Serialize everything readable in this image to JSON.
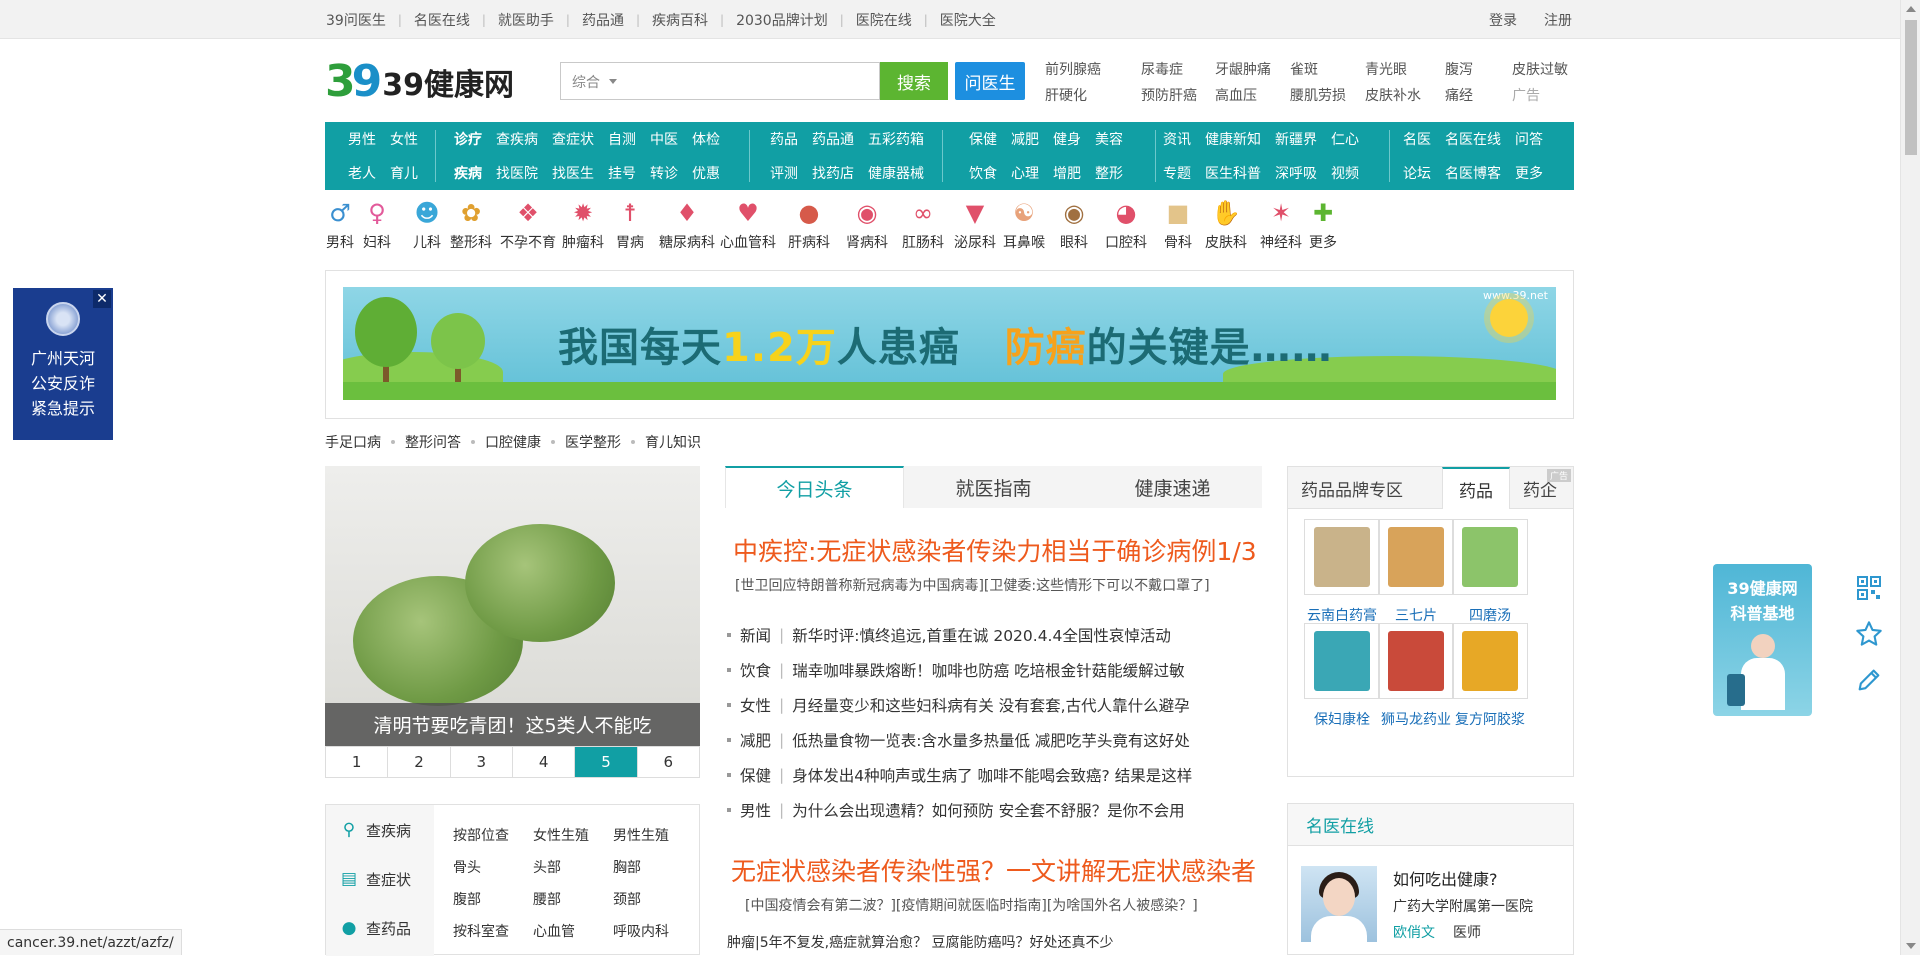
{
  "topbar": {
    "links": [
      "39问医生",
      "名医在线",
      "就医助手",
      "药品通",
      "疾病百科",
      "2030品牌计划",
      "医院在线",
      "医院大全"
    ],
    "login": "登录",
    "register": "注册"
  },
  "logo": {
    "digits_3": "3",
    "digits_9": "9",
    "name": "39健康网"
  },
  "search": {
    "category": "综合",
    "button": "搜索",
    "ask_doctor": "问医生"
  },
  "hotwords": {
    "row1": [
      "前列腺癌",
      "尿毒症",
      "牙龈肿痛",
      "雀斑",
      "青光眼",
      "腹泻",
      "皮肤过敏"
    ],
    "row2": [
      "肝硬化",
      "预防肝癌",
      "高血压",
      "腰肌劳损",
      "皮肤补水",
      "痛经",
      "广告"
    ]
  },
  "nav": {
    "g1": {
      "r1": [
        "男性",
        "女性"
      ],
      "r2": [
        "老人",
        "育儿"
      ]
    },
    "g2": {
      "r1": [
        "诊疗",
        "查疾病",
        "查症状",
        "自测",
        "中医",
        "体检"
      ],
      "r2": [
        "疾病",
        "找医院",
        "找医生",
        "挂号",
        "转诊",
        "优惠"
      ]
    },
    "g3": {
      "r1": [
        "药品",
        "药品通",
        "五彩药箱"
      ],
      "r2": [
        "评测",
        "找药店",
        "健康器械"
      ]
    },
    "g4": {
      "r1": [
        "保健",
        "减肥",
        "健身",
        "美容"
      ],
      "r2": [
        "饮食",
        "心理",
        "增肥",
        "整形"
      ]
    },
    "g5": {
      "r1": [
        "资讯",
        "健康新知",
        "新疆界",
        "仁心"
      ],
      "r2": [
        "专题",
        "医生科普",
        "深呼吸",
        "视频"
      ]
    },
    "g6": {
      "r1": [
        "名医",
        "名医在线",
        "问答"
      ],
      "r2": [
        "论坛",
        "名医博客",
        "更多"
      ]
    }
  },
  "depts": [
    {
      "label": "男科",
      "icon": "male-icon"
    },
    {
      "label": "妇科",
      "icon": "female-icon"
    },
    {
      "label": "儿科",
      "icon": "child-icon"
    },
    {
      "label": "整形科",
      "icon": "plastic-surgery-icon"
    },
    {
      "label": "不孕不育",
      "icon": "infertility-icon"
    },
    {
      "label": "肿瘤科",
      "icon": "tumor-icon"
    },
    {
      "label": "胃病",
      "icon": "stomach-icon"
    },
    {
      "label": "糖尿病科",
      "icon": "diabetes-icon"
    },
    {
      "label": "心血管科",
      "icon": "heart-icon"
    },
    {
      "label": "肝病科",
      "icon": "liver-icon"
    },
    {
      "label": "肾病科",
      "icon": "kidney-icon"
    },
    {
      "label": "肛肠科",
      "icon": "intestine-icon"
    },
    {
      "label": "泌尿科",
      "icon": "urology-icon"
    },
    {
      "label": "耳鼻喉",
      "icon": "ent-icon"
    },
    {
      "label": "眼科",
      "icon": "eye-icon"
    },
    {
      "label": "口腔科",
      "icon": "mouth-icon"
    },
    {
      "label": "骨科",
      "icon": "bone-icon"
    },
    {
      "label": "皮肤科",
      "icon": "skin-icon"
    },
    {
      "label": "神经科",
      "icon": "neuron-icon"
    },
    {
      "label": "更多",
      "icon": "plus-icon"
    }
  ],
  "banner": {
    "text_a": "我国每天",
    "text_num": "1.2万",
    "text_b": "人患癌",
    "text_c": "防癌",
    "text_d": "的关键是……",
    "url": "www.39.net"
  },
  "tags": [
    "手足口病",
    "整形问答",
    "口腔健康",
    "医学整形",
    "育儿知识"
  ],
  "slide": {
    "caption": "清明节要吃青团！这5类人不能吃",
    "pages": [
      "1",
      "2",
      "3",
      "4",
      "5",
      "6"
    ],
    "active_page": "5"
  },
  "lookup": {
    "side": [
      "查疾病",
      "查症状",
      "查药品"
    ],
    "grid": [
      [
        "按部位查",
        "女性生殖",
        "男性生殖"
      ],
      [
        "骨头",
        "头部",
        "胸部"
      ],
      [
        "腹部",
        "腰部",
        "颈部"
      ],
      [
        "按科室查",
        "心血管",
        "呼吸内科"
      ]
    ]
  },
  "news": {
    "tabs": [
      "今日头条",
      "就医指南",
      "健康速递"
    ],
    "headline": "中疾控:无症状感染者传染力相当于确诊病例1/3",
    "subline": "[世卫回应特朗普称新冠病毒为中国病毒][卫健委:这些情形下可以不戴口罩了]",
    "items": [
      {
        "cat": "新闻",
        "text": "新华时评:慎终追远,首重在诚  2020.4.4全国性哀悼活动"
      },
      {
        "cat": "饮食",
        "text": "瑞幸咖啡暴跌熔断！咖啡也防癌  吃培根金针菇能缓解过敏"
      },
      {
        "cat": "女性",
        "text": "月经量变少和这些妇科病有关  没有套套,古代人靠什么避孕"
      },
      {
        "cat": "减肥",
        "text": "低热量食物一览表:含水量多热量低  减肥吃芋头竟有这好处"
      },
      {
        "cat": "保健",
        "text": "身体发出4种响声或生病了  咖啡不能喝会致癌? 结果是这样"
      },
      {
        "cat": "男性",
        "text": "为什么会出现遗精？如何预防  安全套不舒服？是你不会用"
      }
    ],
    "headline2": "无症状感染者传染性强？一文讲解无症状感染者",
    "subline2": "[中国疫情会有第二波？][疫情期间就医临时指南][为啥国外名人被感染？]",
    "items2": [
      {
        "cat": "肿瘤",
        "text": "5年不复发,癌症就算治愈？  豆腐能防癌吗？好处还真不少"
      }
    ]
  },
  "drugs": {
    "tabs": [
      "药品品牌专区",
      "药品",
      "药企"
    ],
    "ad": "广告",
    "items": [
      {
        "label": "云南白药膏",
        "color": "#c9b38a"
      },
      {
        "label": "三七片",
        "color": "#d8a35a"
      },
      {
        "label": "四磨汤",
        "color": "#8cc46a"
      },
      {
        "label": "保妇康栓",
        "color": "#3aa7b5"
      },
      {
        "label": "狮马龙药业",
        "color": "#c94a3a"
      },
      {
        "label": "复方阿胶浆",
        "color": "#e7a826"
      }
    ]
  },
  "doctor": {
    "title": "名医在线",
    "question": "如何吃出健康?",
    "hospital": "广药大学附属第一医院",
    "name": "欧俏文",
    "role": "医师"
  },
  "police": {
    "text": [
      "广州天河",
      "公安反诈",
      "紧急提示"
    ]
  },
  "float_ad": {
    "text": [
      "39健康网",
      "科普基地"
    ]
  },
  "statusbar": {
    "url": "cancer.39.net/azzt/azfz/"
  },
  "colors": {
    "primary": "#119fa4",
    "headline": "#ee5a1d",
    "search_btn": "#5cb531",
    "ask_btn": "#1d8fe0"
  }
}
